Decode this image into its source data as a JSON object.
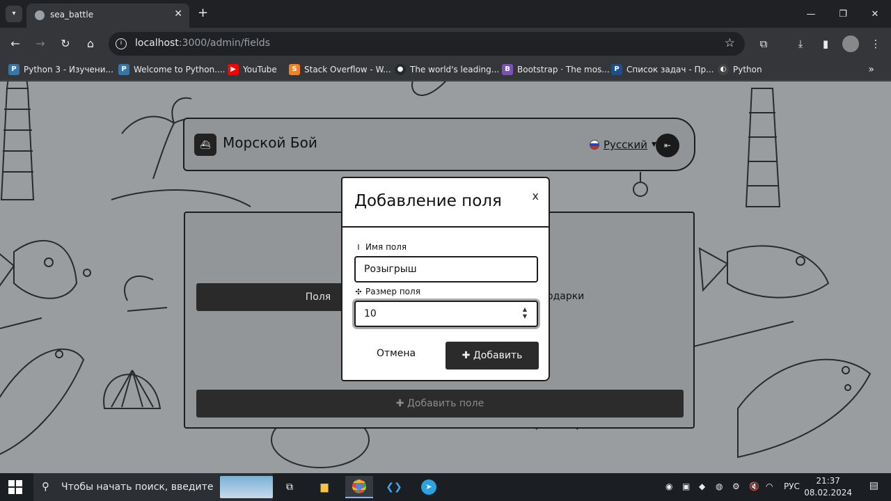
{
  "browser": {
    "tab_title": "sea_battle",
    "tab_close": "✕",
    "new_tab": "+",
    "url_host": "localhost",
    "url_path": ":3000/admin/fields",
    "window_controls": [
      "—",
      "❐",
      "✕"
    ],
    "bookmarks": [
      {
        "label": "Python 3 - Изучени...",
        "icon": "python-icon",
        "color": "#3776ab"
      },
      {
        "label": "Welcome to Python....",
        "icon": "python-icon",
        "color": "#3776ab"
      },
      {
        "label": "YouTube",
        "icon": "youtube-icon",
        "color": "#ff0000"
      },
      {
        "label": "Stack Overflow - W...",
        "icon": "stackoverflow-icon",
        "color": "#f48024"
      },
      {
        "label": "The world's leading...",
        "icon": "github-icon",
        "color": "#24292e"
      },
      {
        "label": "Bootstrap · The mos...",
        "icon": "bootstrap-icon",
        "color": "#7952b3"
      },
      {
        "label": "Список задач - Пр...",
        "icon": "tasks-icon",
        "color": "#1f4e8c"
      },
      {
        "label": "Python",
        "icon": "python-icon",
        "color": "#444"
      }
    ]
  },
  "app": {
    "brand": "Морской Бой",
    "language": "Русский",
    "tabs": {
      "fields": "Поля",
      "prizes": "одарки"
    },
    "add_field": "✚ Добавить поле"
  },
  "modal": {
    "title": "Добавление поля",
    "close": "x",
    "name_label": "Имя поля",
    "name_value": "Розыгрыш",
    "size_label": "Размер поля",
    "size_value": "10",
    "cancel": "Отмена",
    "submit": "✚ Добавить"
  },
  "taskbar": {
    "search_placeholder": "Чтобы начать поиск, введите",
    "lang": "РУС",
    "time": "21:37",
    "date": "08.02.2024"
  },
  "colors": {
    "page_bg": "#9a9d9f",
    "dark_button": "#2b2b2b",
    "chrome_bg": "#35363a"
  }
}
